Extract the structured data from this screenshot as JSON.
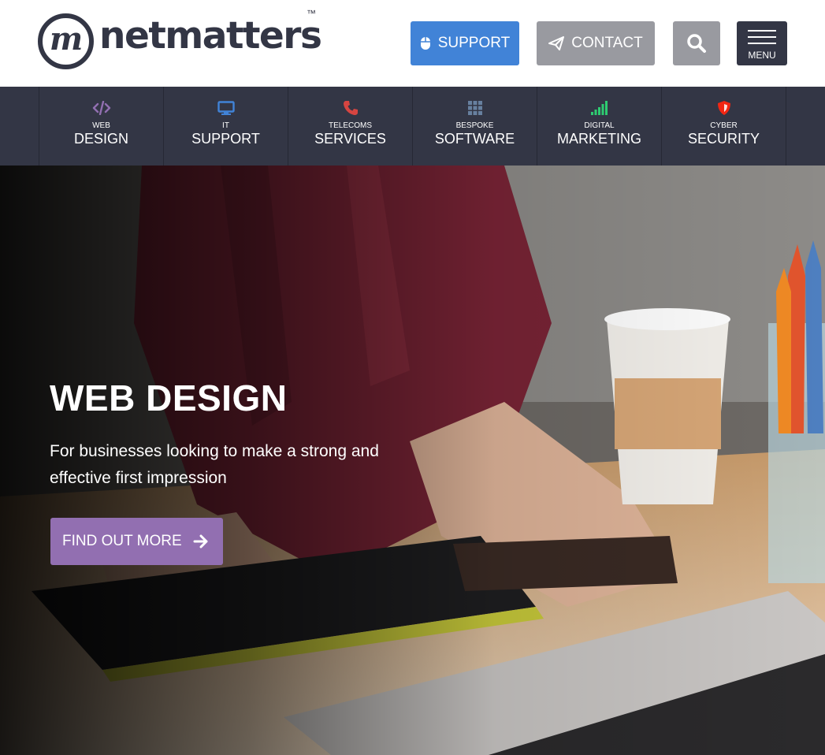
{
  "brand": {
    "name": "netmatters",
    "mark": "m",
    "trademark": "™"
  },
  "header": {
    "support_label": "SUPPORT",
    "contact_label": "CONTACT",
    "menu_label": "MENU"
  },
  "services": [
    {
      "small": "WEB",
      "big": "DESIGN",
      "icon": "code-icon",
      "color": "#926fb1"
    },
    {
      "small": "IT",
      "big": "SUPPORT",
      "icon": "monitor-icon",
      "color": "#4183d7"
    },
    {
      "small": "TELECOMS",
      "big": "SERVICES",
      "icon": "phone-icon",
      "color": "#d64541"
    },
    {
      "small": "BESPOKE",
      "big": "SOFTWARE",
      "icon": "grid-icon",
      "color": "#67809f"
    },
    {
      "small": "DIGITAL",
      "big": "MARKETING",
      "icon": "signal-icon",
      "color": "#2ecc71"
    },
    {
      "small": "CYBER",
      "big": "SECURITY",
      "icon": "shield-icon",
      "color": "#f22613"
    }
  ],
  "hero": {
    "title": "WEB DESIGN",
    "subtitle": "For businesses looking to make a strong and effective first impression",
    "cta_label": "FIND OUT MORE"
  },
  "colors": {
    "dark": "#333645",
    "support_blue": "#4183d7",
    "contact_grey": "#999aa0",
    "cta_purple": "#926fb1"
  }
}
